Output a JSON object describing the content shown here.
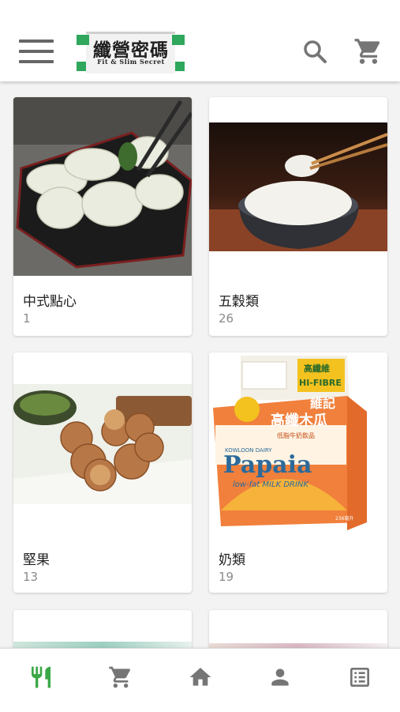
{
  "header": {
    "logo_title": "纖營密碼",
    "logo_subtitle": "Fit & Slim Secret",
    "icons": [
      "menu-icon",
      "search-icon",
      "cart-icon"
    ]
  },
  "categories": [
    {
      "name": "中式點心",
      "count": "1",
      "image": "dumplings"
    },
    {
      "name": "五穀類",
      "count": "26",
      "image": "rice-bowl"
    },
    {
      "name": "堅果",
      "count": "13",
      "image": "walnuts"
    },
    {
      "name": "奶類",
      "count": "19",
      "image": "milk-carton"
    }
  ],
  "milk_carton": {
    "brand": "維記",
    "fibre_cn": "高纖維",
    "fibre_en": "HI-FIBRE",
    "flavor_cn": "高纖木瓜",
    "flavor_sub": "低脂牛奶飲品",
    "dairy": "KOWLOON DAIRY",
    "product": "Papaia",
    "desc": "low-fat MILK DRINK",
    "volume": "236毫升"
  },
  "bottom_nav": [
    {
      "icon": "restaurant-icon",
      "active": true
    },
    {
      "icon": "cart-icon",
      "active": false
    },
    {
      "icon": "home-icon",
      "active": false
    },
    {
      "icon": "person-icon",
      "active": false
    },
    {
      "icon": "list-icon",
      "active": false
    }
  ],
  "colors": {
    "accent": "#3aa846",
    "icon_gray": "#757575",
    "background": "#f3f3f3"
  }
}
